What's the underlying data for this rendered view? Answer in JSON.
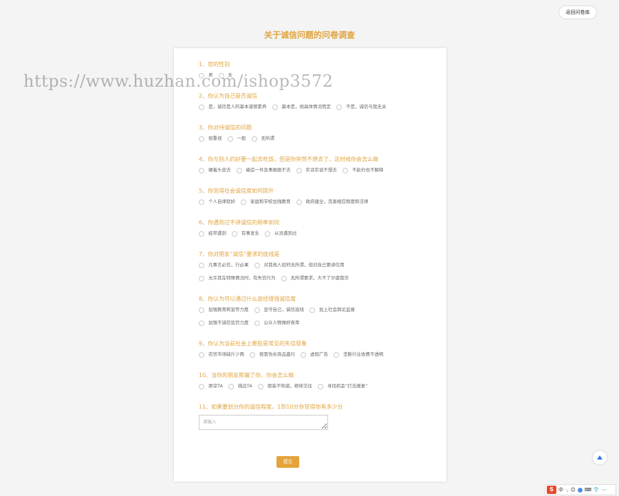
{
  "header": {
    "back_label": "返回问卷库"
  },
  "page_title": "关于诚信问题的问卷调查",
  "watermark": "https://www.huzhan.com/ishop3572",
  "questions": [
    {
      "title": "1、您的性别",
      "rows": [
        [
          "男",
          "女"
        ]
      ]
    },
    {
      "title": "2、你认为自己是否诚信",
      "rows": [
        [
          "是，诚信是人的基本道德素养",
          "基本是，视具体情况而定",
          "不是，诚信与我无关"
        ]
      ]
    },
    {
      "title": "3、你对待诚信的问题",
      "rows": [
        [
          "很重视",
          "一般",
          "无所谓"
        ]
      ]
    },
    {
      "title": "4、你与别人约好要一起去吃饭，但是你突然不想去了，这时候你会怎么做",
      "rows": [
        [
          "硬着头皮去",
          "编造一件急事推脱不去",
          "实话实说不想去",
          "不赴约也不解释"
        ]
      ]
    },
    {
      "title": "5、你觉得社会诚信度如何提升",
      "rows": [
        [
          "个人自律就好",
          "家庭和学校加强教育",
          "政府建全，完善相应制度和法律"
        ]
      ]
    },
    {
      "title": "6、你遇到过不讲诚信的频率如何",
      "rows": [
        [
          "经常遇到",
          "有事发生",
          "从没遇到过"
        ]
      ]
    },
    {
      "title": "7、你对朋友“诚信”要求的底线是",
      "rows": [
        [
          "凡事言必信，行必果",
          "对其他人如何无所谓，但对自己要讲信用"
        ],
        [
          "允许其在特殊情况时，有失信行为",
          "无所谓要求，大不了尔虞我诈"
        ]
      ]
    },
    {
      "title": "8、你认为可以通过什么途径增强诚信度",
      "rows": [
        [
          "加强教育和宣传力度",
          "坚守自己，诚信底线",
          "加上社会舆论监督"
        ],
        [
          "加强不诚信惩罚力度",
          "公众人物做好表率"
        ]
      ]
    },
    {
      "title": "9、你认为当前社会上哪些是常见的失信现象",
      "rows": [
        [
          "农贸市场缺斤少两",
          "假冒伪劣商品盛行",
          "虚假广告",
          "垄断行业收费不透明"
        ]
      ]
    },
    {
      "title": "10、当你的朋友欺骗了你，你会怎么做",
      "rows": [
        [
          "原谅TA",
          "疏远TA",
          "假装不知道，继续交往",
          "寻找机会“打击报复”"
        ]
      ]
    },
    {
      "title": "11、如果要划分你的诚信程度，1到10分你觉得你有多少分",
      "textarea_placeholder": "请输入"
    }
  ],
  "submit_label": "提交",
  "ime": {
    "logo": "S",
    "items": [
      "中",
      "·,",
      "☺",
      "🎤",
      "⌨",
      "👕",
      "⋯"
    ]
  },
  "colors": {
    "accent": "#e0a33e",
    "submit_bg": "#e5a43b"
  }
}
